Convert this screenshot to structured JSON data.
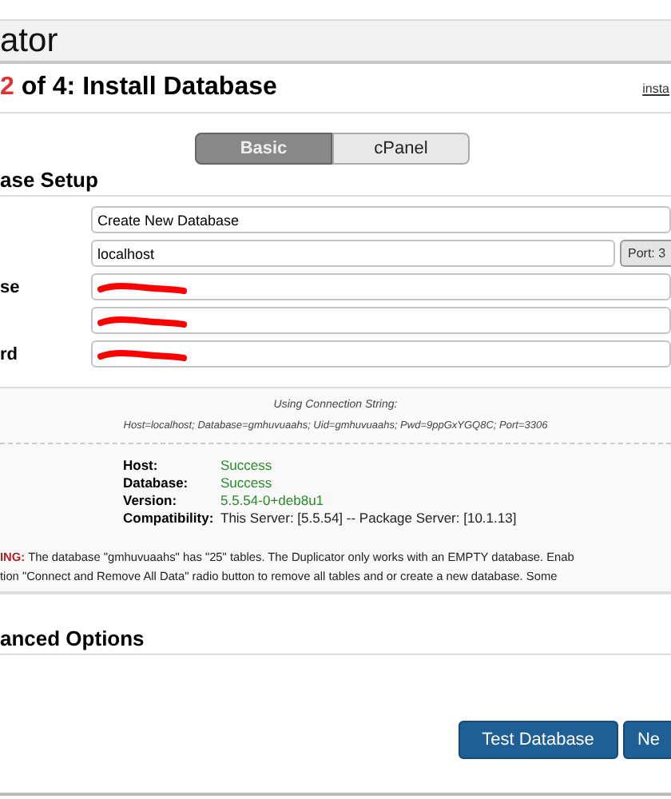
{
  "header": {
    "title": "ator"
  },
  "step": {
    "number": "2",
    "title": "of 4: Install Database",
    "link": "insta"
  },
  "view_toggle": [
    {
      "label": "Basic",
      "selected": true
    },
    {
      "label": "cPanel",
      "selected": false
    }
  ],
  "setup": {
    "heading": "ase Setup",
    "fields": [
      {
        "kind": "select",
        "value": "Create New Database"
      },
      {
        "kind": "text",
        "value": "localhost",
        "addon": "Port: 3"
      },
      {
        "kind": "redacted",
        "label": "se"
      },
      {
        "kind": "redacted"
      },
      {
        "kind": "redacted",
        "label": "rd"
      }
    ]
  },
  "connection": {
    "caption": "Using Connection String:",
    "string": "Host=localhost; Database=gmhuvuaahs; Uid=gmhuvuaahs; Pwd=9ppGxYGQ8C; Port=3306"
  },
  "results": [
    {
      "label": "Host:",
      "value": "Success",
      "kind": "success"
    },
    {
      "label": "Database:",
      "value": "Success",
      "kind": "success"
    },
    {
      "label": "Version:",
      "value": "5.5.54-0+deb8u1",
      "kind": "success"
    },
    {
      "label": "Compatibility:",
      "value": "This Server: [5.5.54] -- Package Server: [10.1.13]",
      "kind": "plain"
    }
  ],
  "warning": {
    "label": "ING:",
    "lines": [
      "The database \"gmhuvuaahs\" has \"25\" tables. The Duplicator only works with an EMPTY database. Enab",
      "tion \"Connect and Remove All Data\" radio button to remove all tables and or create a new database. Some"
    ]
  },
  "advanced": {
    "heading": "anced Options"
  },
  "buttons": [
    {
      "label": "Test Database"
    },
    {
      "label": "Ne"
    }
  ]
}
